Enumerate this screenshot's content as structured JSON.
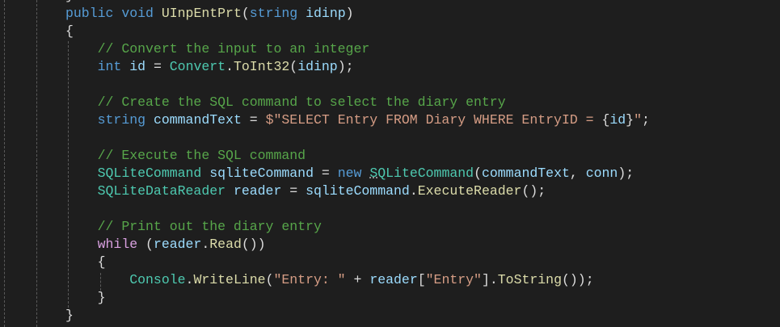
{
  "editor": {
    "theme_colors": {
      "background": "#1e1e1e",
      "keyword": "#569cd6",
      "control": "#d8a0df",
      "type": "#4ec9b0",
      "method": "#dcdcaa",
      "variable": "#9cdcfe",
      "comment": "#57a64a",
      "string": "#d69d85",
      "plain": "#dcdcdc"
    },
    "lines": [
      {
        "indent": 0,
        "tokens": [
          [
            "}",
            "pl"
          ]
        ]
      },
      {
        "indent": 0,
        "tokens": [
          [
            "public",
            "kw"
          ],
          [
            " ",
            "pl"
          ],
          [
            "void",
            "kw"
          ],
          [
            " ",
            "pl"
          ],
          [
            "UInpEntPrt",
            "fn"
          ],
          [
            "(",
            "pl"
          ],
          [
            "string",
            "kw"
          ],
          [
            " ",
            "pl"
          ],
          [
            "idinp",
            "var"
          ],
          [
            ")",
            "pl"
          ]
        ]
      },
      {
        "indent": 0,
        "tokens": [
          [
            "{",
            "pl"
          ]
        ]
      },
      {
        "indent": 1,
        "tokens": [
          [
            "// Convert the input to an integer",
            "cm"
          ]
        ]
      },
      {
        "indent": 1,
        "tokens": [
          [
            "int",
            "kw"
          ],
          [
            " ",
            "pl"
          ],
          [
            "id",
            "var"
          ],
          [
            " = ",
            "pl"
          ],
          [
            "Convert",
            "type"
          ],
          [
            ".",
            "pl"
          ],
          [
            "ToInt32",
            "fn"
          ],
          [
            "(",
            "pl"
          ],
          [
            "idinp",
            "var"
          ],
          [
            ");",
            "pl"
          ]
        ]
      },
      {
        "indent": 0,
        "tokens": []
      },
      {
        "indent": 1,
        "tokens": [
          [
            "// Create the SQL command to select the diary entry",
            "cm"
          ]
        ]
      },
      {
        "indent": 1,
        "tokens": [
          [
            "string",
            "kw"
          ],
          [
            " ",
            "pl"
          ],
          [
            "commandText",
            "var"
          ],
          [
            " = ",
            "pl"
          ],
          [
            "$\"SELECT Entry FROM Diary WHERE EntryID = ",
            "str"
          ],
          [
            "{",
            "pl"
          ],
          [
            "id",
            "var"
          ],
          [
            "}",
            "pl"
          ],
          [
            "\"",
            "str"
          ],
          [
            ";",
            "pl"
          ]
        ]
      },
      {
        "indent": 0,
        "tokens": []
      },
      {
        "indent": 1,
        "tokens": [
          [
            "// Execute the SQL command",
            "cm"
          ]
        ]
      },
      {
        "indent": 1,
        "tokens": [
          [
            "SQLiteCommand",
            "type"
          ],
          [
            " ",
            "pl"
          ],
          [
            "sqliteCommand",
            "var"
          ],
          [
            " = ",
            "pl"
          ],
          [
            "new",
            "kw"
          ],
          [
            " ",
            "pl"
          ],
          [
            "S",
            "type sq"
          ],
          [
            "QLiteCommand",
            "type"
          ],
          [
            "(",
            "pl"
          ],
          [
            "commandText",
            "var"
          ],
          [
            ", ",
            "pl"
          ],
          [
            "conn",
            "var"
          ],
          [
            ");",
            "pl"
          ]
        ]
      },
      {
        "indent": 1,
        "tokens": [
          [
            "SQLiteDataReader",
            "type"
          ],
          [
            " ",
            "pl"
          ],
          [
            "reader",
            "var"
          ],
          [
            " = ",
            "pl"
          ],
          [
            "sqliteCommand",
            "var"
          ],
          [
            ".",
            "pl"
          ],
          [
            "ExecuteReader",
            "fn"
          ],
          [
            "();",
            "pl"
          ]
        ]
      },
      {
        "indent": 0,
        "tokens": []
      },
      {
        "indent": 1,
        "tokens": [
          [
            "// Print out the diary entry",
            "cm"
          ]
        ]
      },
      {
        "indent": 1,
        "tokens": [
          [
            "while",
            "ctl"
          ],
          [
            " (",
            "pl"
          ],
          [
            "reader",
            "var"
          ],
          [
            ".",
            "pl"
          ],
          [
            "Read",
            "fn"
          ],
          [
            "())",
            "pl"
          ]
        ]
      },
      {
        "indent": 1,
        "tokens": [
          [
            "{",
            "pl"
          ]
        ]
      },
      {
        "indent": 2,
        "tokens": [
          [
            "Console",
            "type"
          ],
          [
            ".",
            "pl"
          ],
          [
            "WriteLine",
            "fn"
          ],
          [
            "(",
            "pl"
          ],
          [
            "\"Entry: \"",
            "str"
          ],
          [
            " + ",
            "pl"
          ],
          [
            "reader",
            "var"
          ],
          [
            "[",
            "pl"
          ],
          [
            "\"Entry\"",
            "str"
          ],
          [
            "].",
            "pl"
          ],
          [
            "ToString",
            "fn"
          ],
          [
            "());",
            "pl"
          ]
        ]
      },
      {
        "indent": 1,
        "tokens": [
          [
            "}",
            "pl"
          ]
        ]
      },
      {
        "indent": 0,
        "tokens": [
          [
            "}",
            "pl"
          ]
        ]
      }
    ]
  }
}
